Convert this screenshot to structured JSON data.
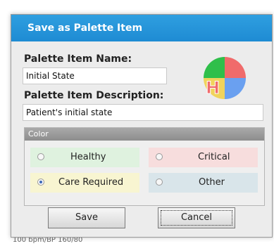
{
  "background": {
    "status_text": "100 bpm/BP 160/80"
  },
  "dialog": {
    "title": "Save as Palette Item",
    "name_label": "Palette Item Name:",
    "name_value": "Initial State",
    "description_label": "Palette Item Description:",
    "description_value": "Patient's initial state",
    "color_group_title": "Color",
    "options": [
      {
        "label": "Healthy",
        "selected": false,
        "bg": "#dff2df"
      },
      {
        "label": "Critical",
        "selected": false,
        "bg": "#f7dddd"
      },
      {
        "label": "Care Required",
        "selected": true,
        "bg": "#f8f5d1"
      },
      {
        "label": "Other",
        "selected": false,
        "bg": "#d9e5ea"
      }
    ],
    "buttons": {
      "save": "Save",
      "cancel": "Cancel"
    }
  }
}
